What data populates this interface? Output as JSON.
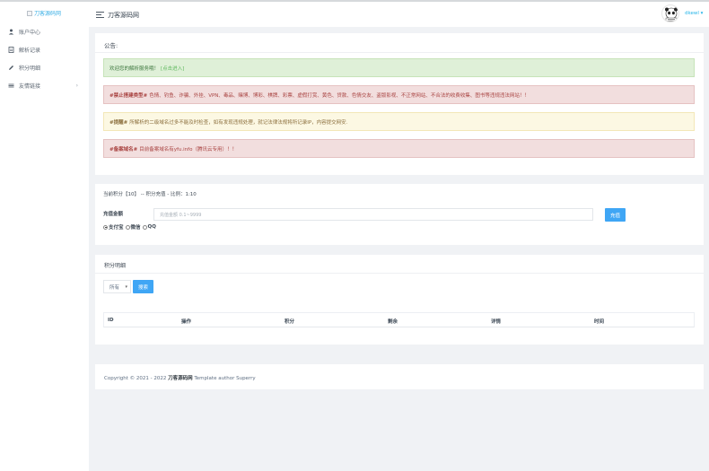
{
  "sidebar": {
    "logo_alt": "刀客源码网",
    "items": [
      {
        "label": "账户中心",
        "icon": "user-icon"
      },
      {
        "label": "解析记录",
        "icon": "file-icon"
      },
      {
        "label": "积分明细",
        "icon": "pencil-icon"
      },
      {
        "label": "友情链接",
        "icon": "menu-lines-icon",
        "chevron": "›"
      }
    ]
  },
  "header": {
    "title": "刀客源码网",
    "username": "dkewl",
    "user_caret": "▾"
  },
  "notice": {
    "title": "公告:",
    "alerts": [
      {
        "type": "success",
        "text": "欢迎您的解析服务哦！",
        "link": "[点击进入]"
      },
      {
        "type": "danger",
        "prefix": "#禁止搭建类型#",
        "text": "色情、钓鱼、诈骗、外挂、VPN、毒品、赌博、博彩、棋牌、彩票、虚假打赏、黄色、贷款、色情交友、盗版影视、不正常网站、不合法的收费收集、图书等违规违法网站！！"
      },
      {
        "type": "warning",
        "prefix": "#提醒#",
        "text": "所解析的二级域名过多不能及时检查，如有发现违规处理，就记法律法规将所记录IP，内容提交网安."
      },
      {
        "type": "danger",
        "prefix": "#备案域名#",
        "text": "目前备案域名有yfu.info（腾讯云专用）！！"
      }
    ]
  },
  "recharge": {
    "info": "当前积分【10】 -- 积分充值 - 比例：1:10",
    "amount_label": "充值金额",
    "amount_placeholder": "充值金额 0.1~9999",
    "submit": "充值",
    "methods": [
      {
        "label": "支付宝",
        "checked": true
      },
      {
        "label": "微信",
        "checked": false
      },
      {
        "label": "QQ",
        "checked": false
      }
    ]
  },
  "points": {
    "title": "积分明细",
    "filter_value": "所有",
    "search": "搜索",
    "columns": [
      "ID",
      "操作",
      "积分",
      "剩余",
      "详情",
      "时间"
    ]
  },
  "footer": {
    "prefix": "Copyright © 2021 - 2022",
    "brand": "刀客源码网",
    "suffix": "Template author Superry"
  },
  "colors": {
    "accent": "#3fa6f5",
    "success_bg": "#dff0d8",
    "danger_bg": "#f2dede",
    "warning_bg": "#fcf8e3"
  }
}
